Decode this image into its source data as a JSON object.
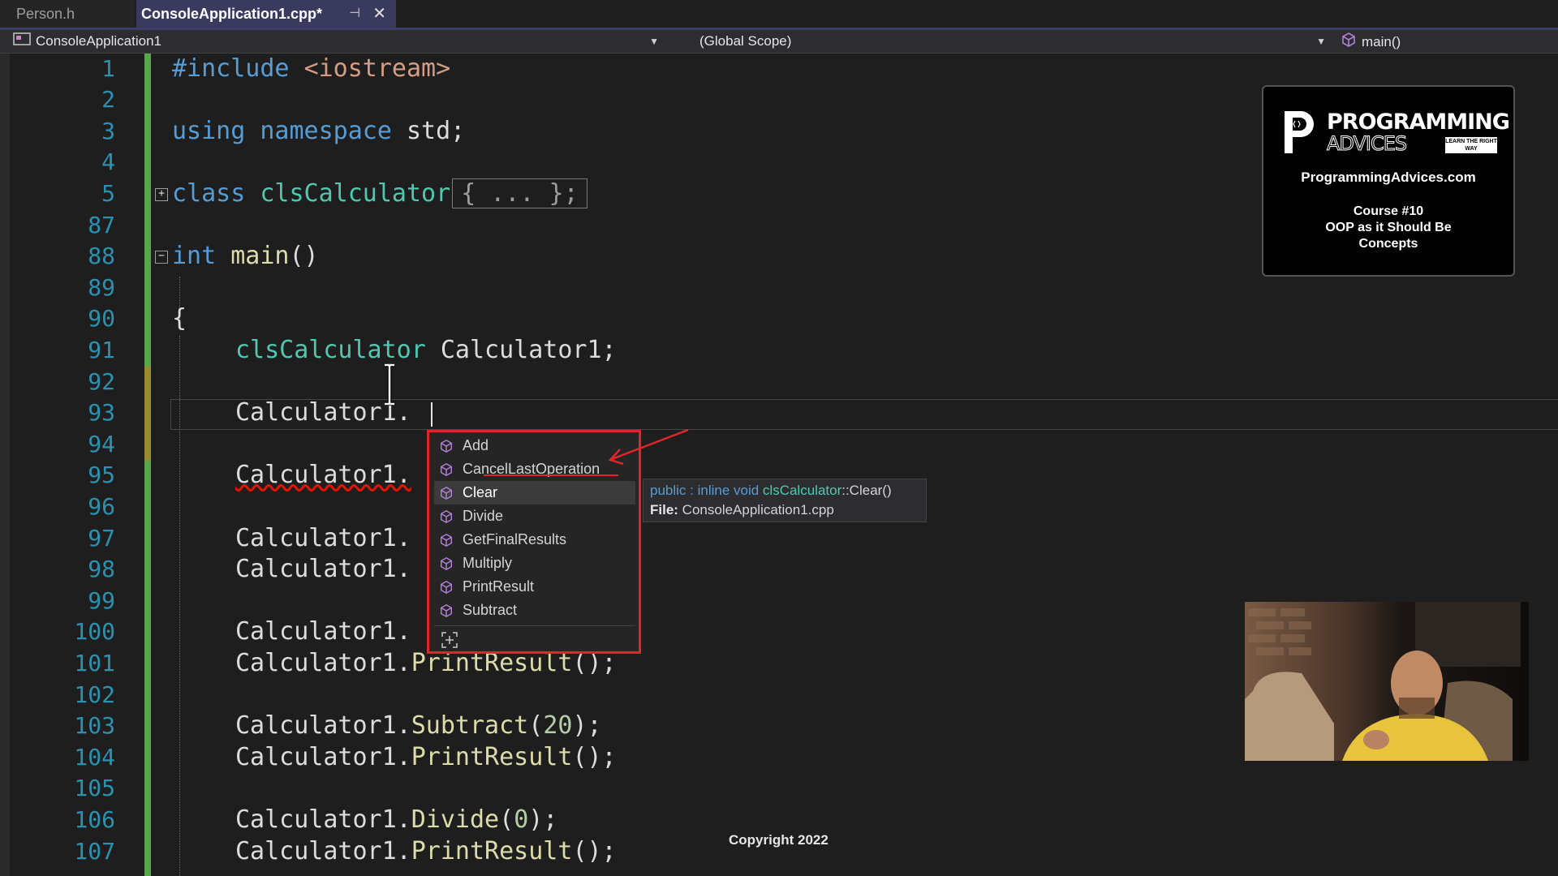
{
  "tabs": [
    {
      "label": "Person.h",
      "active": false
    },
    {
      "label": "ConsoleApplication1.cpp*",
      "active": true
    }
  ],
  "navbar": {
    "project": "ConsoleApplication1",
    "scope": "(Global Scope)",
    "member": "main()"
  },
  "line_numbers": [
    "1",
    "2",
    "3",
    "4",
    "5",
    "87",
    "88",
    "89",
    "90",
    "91",
    "92",
    "93",
    "94",
    "95",
    "96",
    "97",
    "98",
    "99",
    "100",
    "101",
    "102",
    "103",
    "104",
    "105",
    "106",
    "107"
  ],
  "code": {
    "l1_a": "#include ",
    "l1_b": "<iostream>",
    "l3_a": "using",
    "l3_b": "namespace",
    "l3_c": " std;",
    "l5_a": "class",
    "l5_b": "clsCalculator",
    "l5_c": "{ ... };",
    "l88_a": "int",
    "l88_b": "main",
    "l88_c": "()",
    "l90": "{",
    "l91_a": "clsCalculator",
    "l91_b": " Calculator1;",
    "l93": "Calculator1.",
    "l95": "Calculator1.",
    "l97": "Calculator1.",
    "l98_a": "Calculator1.",
    "l98_b": ";",
    "l100": "Calculator1.",
    "l101_a": "Calculator1.",
    "l101_b": "PrintResult",
    "l101_c": "();",
    "l103_a": "Calculator1.",
    "l103_b": "Subtract",
    "l103_c": "(",
    "l103_d": "20",
    "l103_e": ");",
    "l104_a": "Calculator1.",
    "l104_b": "PrintResult",
    "l104_c": "();",
    "l106_a": "Calculator1.",
    "l106_b": "Divide",
    "l106_c": "(",
    "l106_d": "0",
    "l106_e": ");",
    "l107_a": "Calculator1.",
    "l107_b": "PrintResult",
    "l107_c": "();"
  },
  "intellisense": {
    "items": [
      "Add",
      "CancelLastOperation",
      "Clear",
      "Divide",
      "GetFinalResults",
      "Multiply",
      "PrintResult",
      "Subtract"
    ],
    "selected": "Clear"
  },
  "tooltip": {
    "sig_access": "public",
    "sig_sep": " : inline void ",
    "sig_class": "clsCalculator",
    "sig_rest": "::Clear()",
    "file_label": "File:",
    "file_name": " ConsoleApplication1.cpp"
  },
  "logo": {
    "line1": "PROGRAMMING",
    "line2": "ADVICES",
    "tag": "LEARN THE RIGHT WAY",
    "site": "ProgrammingAdvices.com",
    "course_line1": "Course #10",
    "course_line2": "OOP as it Should Be",
    "course_line3": "Concepts"
  },
  "copyright": "Copyright 2022",
  "colors": {
    "keyword": "#569cd6",
    "type": "#4ec9b0",
    "function": "#dcdcaa",
    "string": "#d69d85",
    "number": "#b5cea8",
    "line_number": "#2b91af",
    "annotation_red": "#e0262a"
  },
  "icons": {
    "method": "purple-cube-method-icon",
    "pin": "pin-icon",
    "close": "close-icon",
    "filter": "intellisense-filter-icon"
  }
}
